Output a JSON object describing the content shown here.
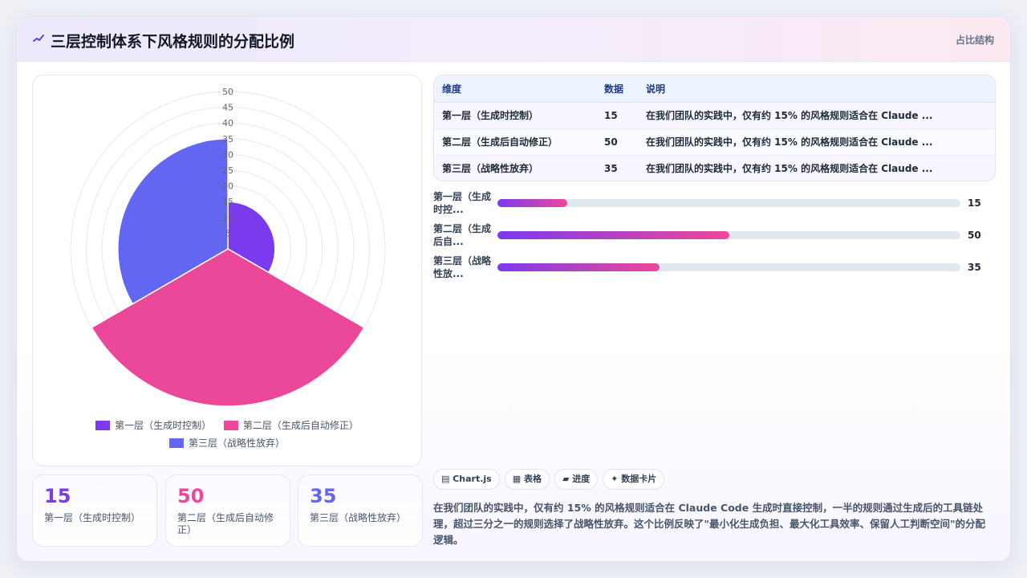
{
  "header": {
    "icon": "chart-spark-icon",
    "title": "三层控制体系下风格规则的分配比例",
    "tag": "占比结构"
  },
  "colors": {
    "layer1": "#7c3aed",
    "layer2": "#ec4899",
    "layer3": "#6366f1"
  },
  "chart_data": {
    "type": "polarArea",
    "categories": [
      "第一层（生成时控制）",
      "第二层（生成后自动修正）",
      "第三层（战略性放弃）"
    ],
    "values": [
      15,
      50,
      35
    ],
    "colors": [
      "#7c3aed",
      "#ec4899",
      "#6366f1"
    ],
    "radial_ticks": [
      "5",
      "10",
      "15",
      "20",
      "25",
      "30",
      "35",
      "40",
      "45",
      "50"
    ],
    "rmax": 50,
    "grid": true,
    "legend": "bottom"
  },
  "legend": {
    "items": [
      "第一层（生成时控制）",
      "第二层（生成后自动修正）",
      "第三层（战略性放弃）"
    ]
  },
  "stats": [
    {
      "value": "15",
      "label": "第一层（生成时控制）",
      "color": "#7c3aed"
    },
    {
      "value": "50",
      "label": "第二层（生成后自动修正）",
      "color": "#ec4899"
    },
    {
      "value": "35",
      "label": "第三层（战略性放弃）",
      "color": "#6366f1"
    }
  ],
  "table": {
    "headers": [
      "维度",
      "数据",
      "说明"
    ],
    "rows": [
      [
        "第一层（生成时控制）",
        "15",
        "在我们团队的实践中，仅有约 15% 的风格规则适合在 Claude ..."
      ],
      [
        "第二层（生成后自动修正）",
        "50",
        "在我们团队的实践中，仅有约 15% 的风格规则适合在 Claude ..."
      ],
      [
        "第三层（战略性放弃）",
        "35",
        "在我们团队的实践中，仅有约 15% 的风格规则适合在 Claude ..."
      ]
    ]
  },
  "progress": {
    "max": 100,
    "items": [
      {
        "label": "第一层（生成时控...",
        "value": 15
      },
      {
        "label": "第二层（生成后自...",
        "value": 50
      },
      {
        "label": "第三层（战略性放...",
        "value": 35
      }
    ]
  },
  "pills": [
    "▤ Chart.js",
    "▦ 表格",
    "▰ 进度",
    "✦ 数据卡片"
  ],
  "summary": "在我们团队的实践中，仅有约 15% 的风格规则适合在 Claude Code 生成时直接控制，一半的规则通过生成后的工具链处理，超过三分之一的规则选择了战略性放弃。这个比例反映了\"最小化生成负担、最大化工具效率、保留人工判断空间\"的分配逻辑。"
}
